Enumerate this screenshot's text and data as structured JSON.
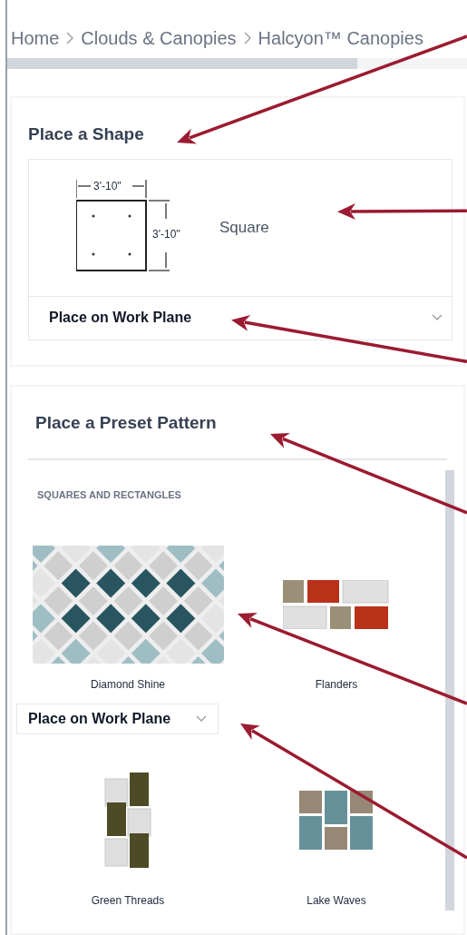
{
  "breadcrumb": [
    "Home",
    "Clouds & Canopies",
    "Halcyon™ Canopies"
  ],
  "shape_panel": {
    "title": "Place a Shape",
    "shape": {
      "name": "Square",
      "width_label": "3'-10\"",
      "height_label": "3'-10\""
    },
    "placement_dropdown": {
      "value": "Place on Work Plane"
    }
  },
  "preset_panel": {
    "title": "Place a Preset Pattern",
    "section": "SQUARES AND RECTANGLES",
    "placement_dropdown": {
      "value": "Place on Work Plane"
    },
    "patterns": [
      {
        "name": "Diamond Shine",
        "kind": "diamond"
      },
      {
        "name": "Flanders",
        "kind": "brick"
      },
      {
        "name": "Green Threads",
        "kind": "threads"
      },
      {
        "name": "Lake Waves",
        "kind": "weave"
      }
    ]
  }
}
